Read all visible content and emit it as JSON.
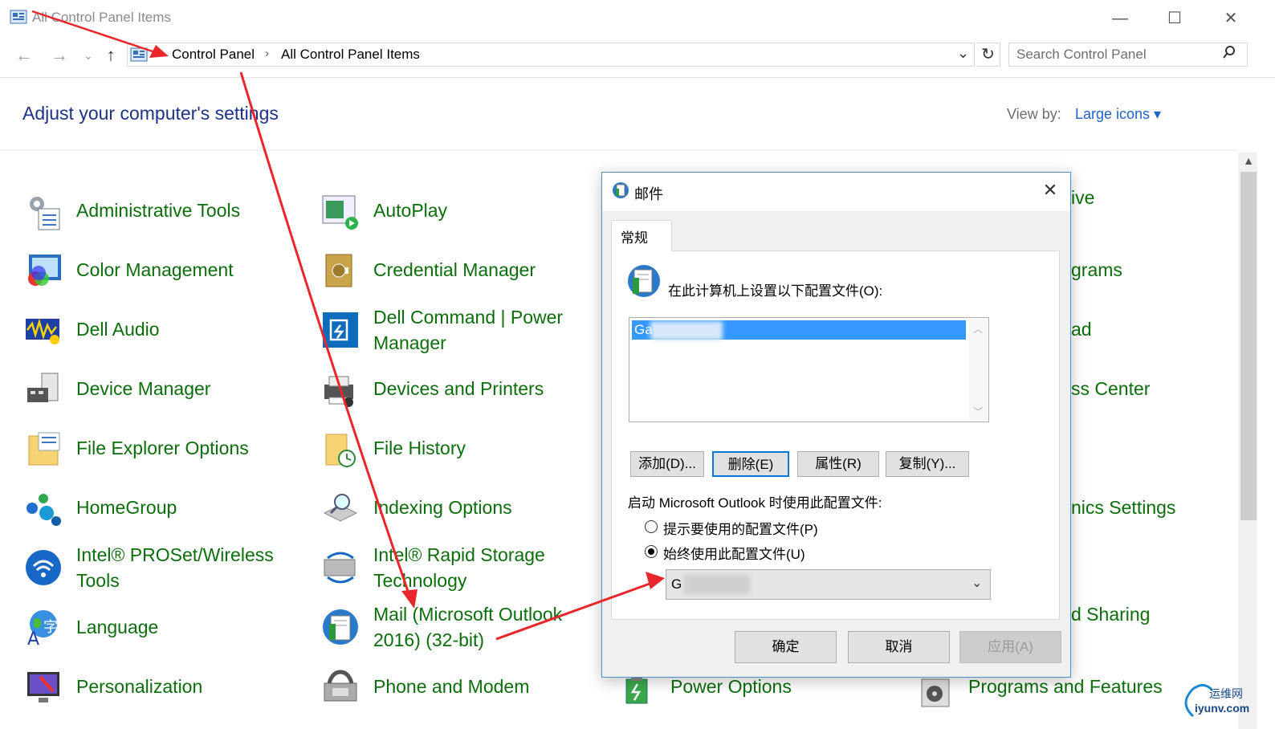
{
  "window": {
    "title": "All Control Panel Items",
    "minimize_label": "—",
    "maximize_label": "☐",
    "close_label": "✕"
  },
  "address_bar": {
    "back": "←",
    "forward": "→",
    "recent": "⌄",
    "up": "↑",
    "breadcrumbs": [
      "Control Panel",
      "All Control Panel Items"
    ],
    "separator": "›",
    "dropdown": "⌄",
    "refresh": "↻"
  },
  "search": {
    "placeholder": "Search Control Panel",
    "icon": "⚲"
  },
  "header": {
    "title": "Adjust your computer's settings",
    "view_by_label": "View by:",
    "view_by_value": "Large icons ▾"
  },
  "items": {
    "col1": [
      {
        "line1": "Administrative Tools",
        "line2": "",
        "icon": "admin-tools-icon"
      },
      {
        "line1": "Color Management",
        "line2": "",
        "icon": "color-management-icon"
      },
      {
        "line1": "Dell Audio",
        "line2": "",
        "icon": "dell-audio-icon"
      },
      {
        "line1": "Device Manager",
        "line2": "",
        "icon": "device-manager-icon"
      },
      {
        "line1": "File Explorer Options",
        "line2": "",
        "icon": "file-explorer-options-icon"
      },
      {
        "line1": "HomeGroup",
        "line2": "",
        "icon": "homegroup-icon"
      },
      {
        "line1": "Intel® PROSet/Wireless",
        "line2": "Tools",
        "icon": "wireless-icon"
      },
      {
        "line1": "Language",
        "line2": "",
        "icon": "language-icon"
      },
      {
        "line1": "Personalization",
        "line2": "",
        "icon": "personalization-icon"
      }
    ],
    "col2": [
      {
        "line1": "AutoPlay",
        "line2": "",
        "icon": "autoplay-icon"
      },
      {
        "line1": "Credential Manager",
        "line2": "",
        "icon": "credential-manager-icon"
      },
      {
        "line1": "Dell Command | Power",
        "line2": "Manager",
        "icon": "dell-power-icon"
      },
      {
        "line1": "Devices and Printers",
        "line2": "",
        "icon": "printer-icon"
      },
      {
        "line1": "File History",
        "line2": "",
        "icon": "file-history-icon"
      },
      {
        "line1": "Indexing Options",
        "line2": "",
        "icon": "indexing-icon"
      },
      {
        "line1": "Intel® Rapid Storage",
        "line2": "Technology",
        "icon": "rapid-storage-icon"
      },
      {
        "line1": "Mail (Microsoft Outlook",
        "line2": "2016) (32-bit)",
        "icon": "mail-icon"
      },
      {
        "line1": "Phone and Modem",
        "line2": "",
        "icon": "phone-modem-icon"
      }
    ],
    "col3_visible": [
      "ive",
      "grams",
      "ad",
      "ss Center",
      "nics Settings",
      "d Sharing"
    ],
    "bottom_row": [
      {
        "label": "Power Options",
        "icon": "power-options-icon"
      },
      {
        "label": "Programs and Features",
        "icon": "programs-features-icon"
      }
    ]
  },
  "mail_dialog": {
    "title": "邮件",
    "close": "✕",
    "tab": "常规",
    "profiles_label": "在此计算机上设置以下配置文件(O):",
    "profile_item": "Ga",
    "buttons": [
      "添加(D)...",
      "删除(E)",
      "属性(R)",
      "复制(Y)..."
    ],
    "startup_label": "启动 Microsoft Outlook 时使用此配置文件:",
    "radio_prompt": "提示要使用的配置文件(P)",
    "radio_always": "始终使用此配置文件(U)",
    "radio_always_selected": true,
    "select_value": "G",
    "select_chevron": "⌄",
    "ok": "确定",
    "cancel": "取消",
    "apply": "应用(A)"
  },
  "watermark": {
    "line1": "运维网",
    "line2": "iyunv.com"
  },
  "colors": {
    "item_text": "#0b6e0b",
    "heading": "#1e3287",
    "link": "#1e64c8",
    "selection": "#3399ff",
    "annotation_arrow": "#e8262b"
  }
}
